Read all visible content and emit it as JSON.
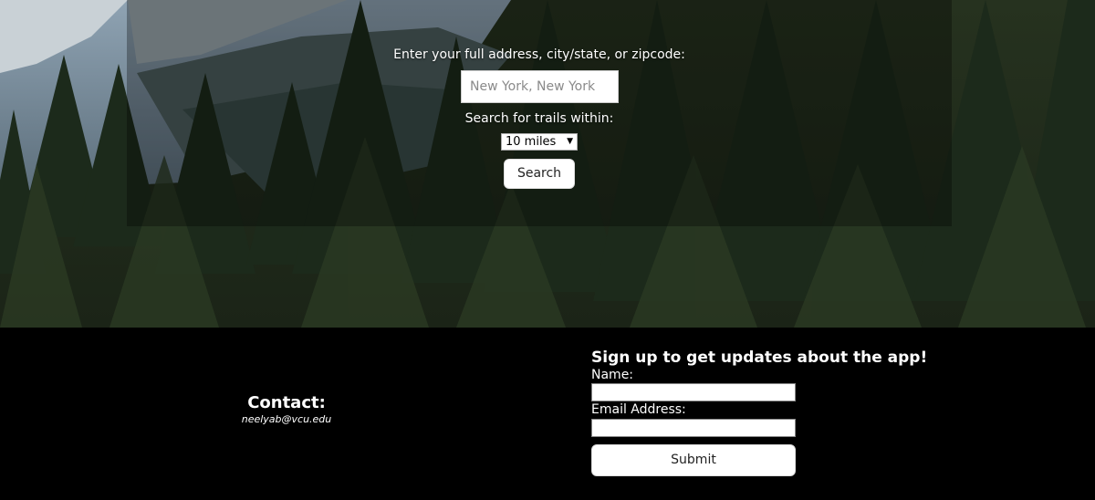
{
  "search": {
    "prompt": "Enter your full address, city/state, or zipcode:",
    "address_placeholder": "New York, New York",
    "within_label": "Search for trails within:",
    "distance_selected": "10 miles",
    "button_label": "Search"
  },
  "footer": {
    "contact_title": "Contact:",
    "contact_email": "neelyab@vcu.edu",
    "signup_title": "Sign up to get updates about the app!",
    "name_label": "Name:",
    "email_label": "Email Address:",
    "submit_label": "Submit"
  },
  "colors": {
    "footer_bg": "#000000",
    "button_bg": "#ffffff",
    "text": "#ffffff"
  },
  "icons": {
    "select_arrow": "dropdown-arrow-icon"
  }
}
